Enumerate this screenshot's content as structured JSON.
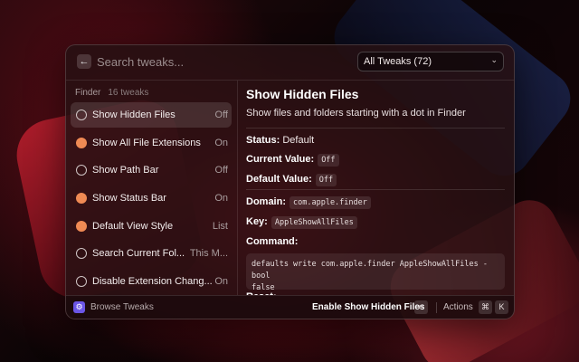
{
  "search": {
    "placeholder": "Search tweaks..."
  },
  "filter": {
    "selected": "All Tweaks (72)"
  },
  "list": {
    "section": "Finder",
    "count": "16 tweaks",
    "items": [
      {
        "name": "Show Hidden Files",
        "value": "Off",
        "state": "off",
        "selected": true
      },
      {
        "name": "Show All File Extensions",
        "value": "On",
        "state": "on"
      },
      {
        "name": "Show Path Bar",
        "value": "Off",
        "state": "off"
      },
      {
        "name": "Show Status Bar",
        "value": "On",
        "state": "on"
      },
      {
        "name": "Default View Style",
        "value": "List",
        "state": "on"
      },
      {
        "name": "Search Current Fol...",
        "value": "This M...",
        "state": "off"
      },
      {
        "name": "Disable Extension Chang...",
        "value": "On",
        "state": "off"
      }
    ]
  },
  "detail": {
    "title": "Show Hidden Files",
    "description": "Show files and folders starting with a dot in Finder",
    "status_label": "Status:",
    "status_value": "Default",
    "current_label": "Current Value:",
    "current_value": "Off",
    "default_label": "Default Value:",
    "default_value": "Off",
    "domain_label": "Domain:",
    "domain_value": "com.apple.finder",
    "key_label": "Key:",
    "key_value": "AppleShowAllFiles",
    "command_label": "Command:",
    "command_line1": "defaults write com.apple.finder AppleShowAllFiles -bool",
    "command_line2": "false",
    "reset_label": "Reset:"
  },
  "footer": {
    "left_label": "Browse Tweaks",
    "primary_action": "Enable Show Hidden Files",
    "enter_key": "↵",
    "actions_label": "Actions",
    "cmd_key": "⌘",
    "k_key": "K"
  },
  "colors": {
    "on": "#ef8a54",
    "accent": "#6b56e6"
  }
}
